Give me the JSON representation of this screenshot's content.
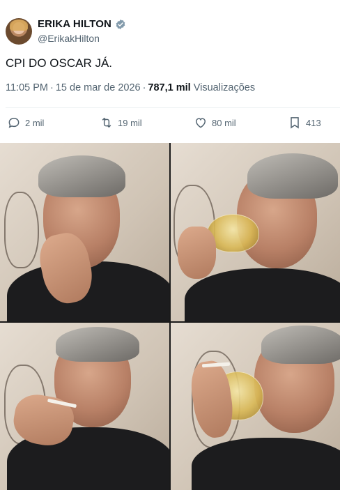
{
  "author": {
    "name": "ERIKA HILTON",
    "handle": "@ErikakHilton",
    "verified": true,
    "verified_color": "#829aab"
  },
  "tweet": {
    "text": "CPI DO OSCAR JÁ.",
    "time": "11:05 PM",
    "date": "15 de mar de 2026",
    "views_count": "787,1 mil",
    "views_label": "Visualizações"
  },
  "actions": {
    "replies": "2 mil",
    "retweets": "19 mil",
    "likes": "80 mil",
    "bookmarks": "413"
  },
  "icons": {
    "reply": "speech-bubble-icon",
    "retweet": "retweet-arrows-icon",
    "like": "heart-icon",
    "bookmark": "bookmark-icon",
    "verified": "verified-badge-icon"
  },
  "colors": {
    "text_primary": "#0f1419",
    "text_secondary": "#536471",
    "divider": "#eff3f4"
  }
}
